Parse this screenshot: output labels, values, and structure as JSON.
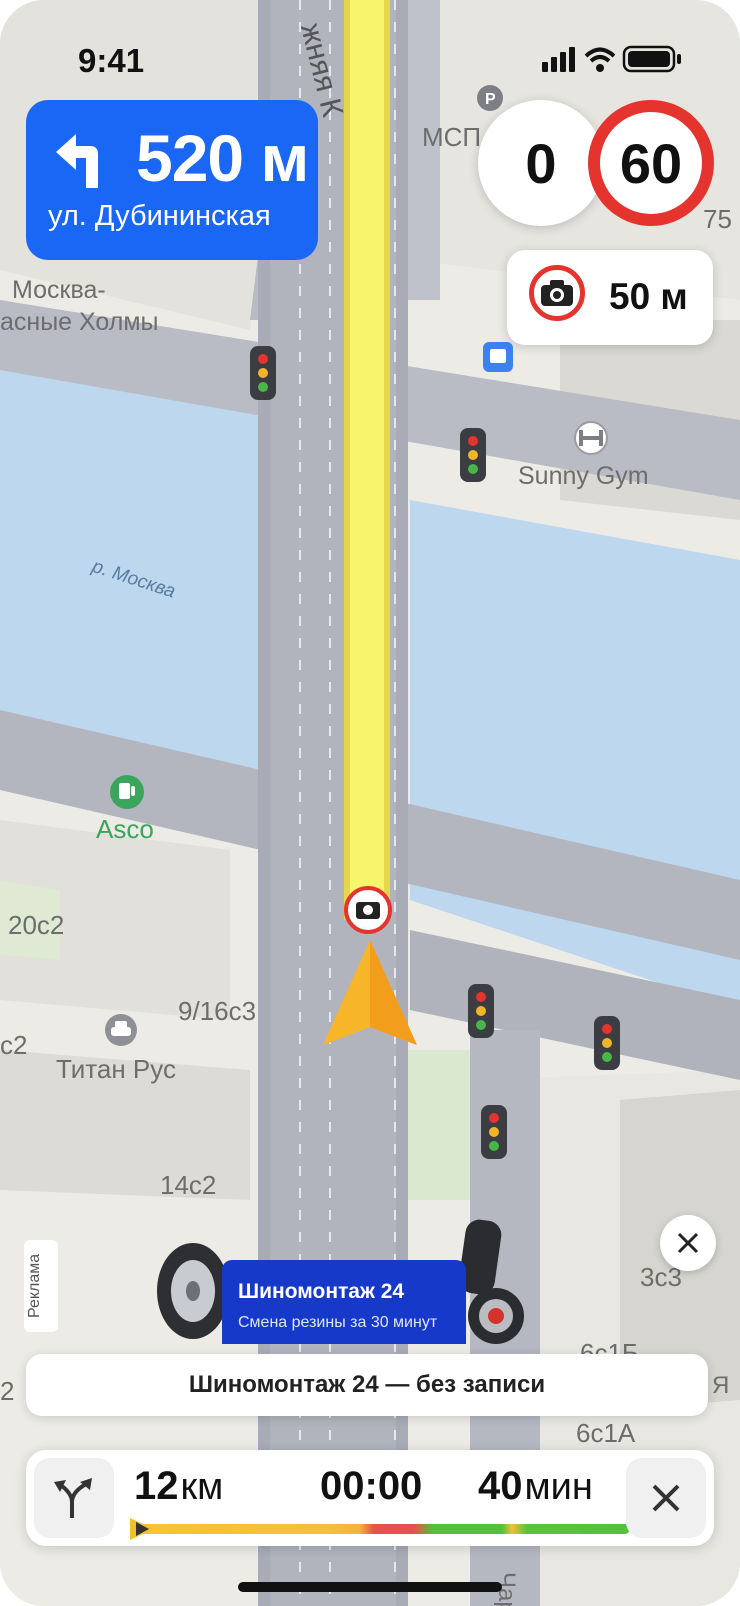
{
  "status_bar": {
    "time": "9:41"
  },
  "maneuver": {
    "distance": "520 м",
    "street": "ул. Дубининская"
  },
  "speed": {
    "current": "0",
    "limit": "60"
  },
  "camera": {
    "distance": "50 м"
  },
  "map_labels": {
    "street_top": "жняя К",
    "district": "Москва-",
    "district_2": "асные Холмы",
    "mcp": "МСП",
    "num_75": "75",
    "gym": "Sunny Gym",
    "river": "р. Москва",
    "asco": "Asco",
    "b20c2": "20с2",
    "b9_16c3": "9/16с3",
    "c2": "c2",
    "titan": "Титан Рус",
    "b14c2": "14с2",
    "b3c3": "3с3",
    "b6c1b": "6с1Б",
    "b6c1a": "6с1А",
    "ya": "Я",
    "chap": "Чар",
    "two": "2"
  },
  "ad": {
    "tag": "Реклама",
    "title": "Шиномонтаж 24",
    "subtitle": "Смена резины за 30 минут",
    "cta": "Шиномонтаж 24 — без записи"
  },
  "route": {
    "distance_value": "12",
    "distance_unit": "км",
    "time_value": "00:00",
    "eta_value": "40",
    "eta_unit": "мин",
    "progress": 0.02
  },
  "colors": {
    "accent": "#1a66f5",
    "route": "#f7f56b",
    "limit_ring": "#e5342d",
    "water": "#bcd7ee"
  }
}
